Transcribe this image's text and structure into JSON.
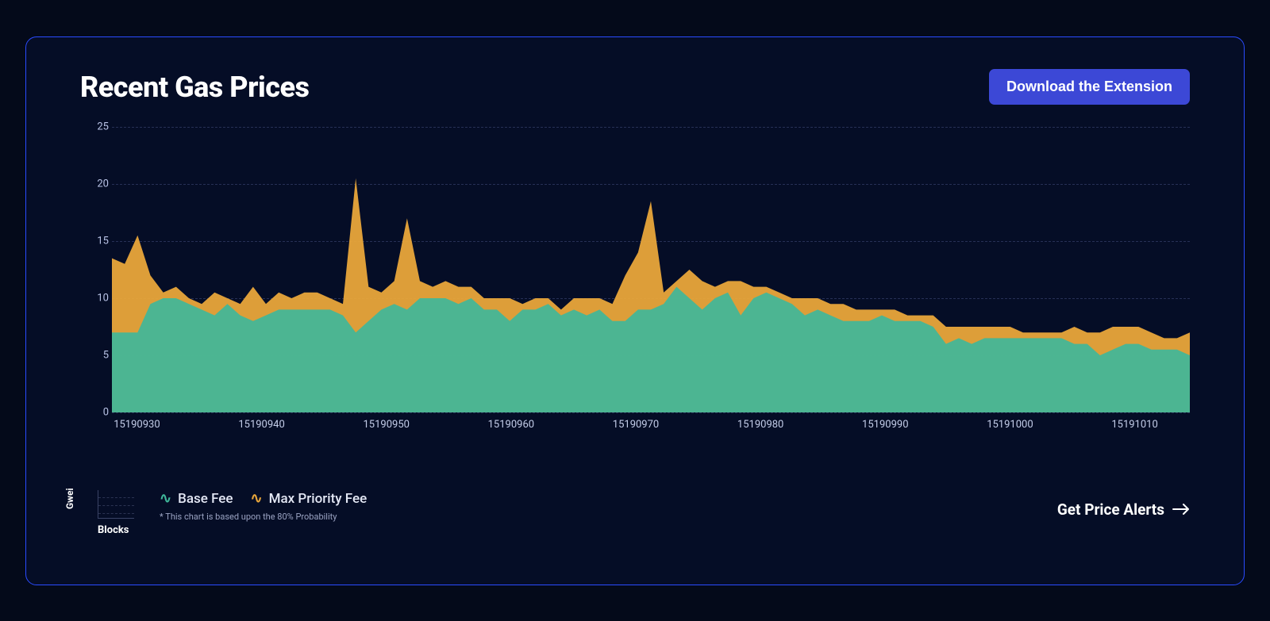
{
  "header": {
    "title": "Recent Gas Prices",
    "download_label": "Download the Extension"
  },
  "chart_data": {
    "type": "area",
    "title": "Recent Gas Prices",
    "xlabel": "Blocks",
    "ylabel": "Gwei",
    "ylim": [
      0,
      25
    ],
    "xlim": [
      15190928,
      15191012
    ],
    "y_ticks": [
      0,
      5,
      10,
      15,
      20,
      25
    ],
    "x_ticks": [
      15190930,
      15190940,
      15190950,
      15190960,
      15190970,
      15190980,
      15190990,
      15191000,
      15191010
    ],
    "categories": [
      15190928,
      15190929,
      15190930,
      15190931,
      15190932,
      15190933,
      15190934,
      15190935,
      15190936,
      15190937,
      15190938,
      15190939,
      15190940,
      15190941,
      15190942,
      15190943,
      15190944,
      15190945,
      15190946,
      15190947,
      15190948,
      15190949,
      15190950,
      15190951,
      15190952,
      15190953,
      15190954,
      15190955,
      15190956,
      15190957,
      15190958,
      15190959,
      15190960,
      15190961,
      15190962,
      15190963,
      15190964,
      15190965,
      15190966,
      15190967,
      15190968,
      15190969,
      15190970,
      15190971,
      15190972,
      15190973,
      15190974,
      15190975,
      15190976,
      15190977,
      15190978,
      15190979,
      15190980,
      15190981,
      15190982,
      15190983,
      15190984,
      15190985,
      15190986,
      15190987,
      15190988,
      15190989,
      15190990,
      15190991,
      15190992,
      15190993,
      15190994,
      15190995,
      15190996,
      15190997,
      15190998,
      15190999,
      15191000,
      15191001,
      15191002,
      15191003,
      15191004,
      15191005,
      15191006,
      15191007,
      15191008,
      15191009,
      15191010,
      15191011,
      15191012
    ],
    "series": [
      {
        "name": "Base Fee",
        "color": "#3fb79a",
        "values": [
          7.0,
          7.0,
          7.0,
          9.5,
          10.0,
          10.0,
          9.5,
          9.0,
          8.5,
          9.5,
          8.5,
          8.0,
          8.5,
          9.0,
          9.0,
          9.0,
          9.0,
          9.0,
          8.5,
          7.0,
          8.0,
          9.0,
          9.5,
          9.0,
          10.0,
          10.0,
          10.0,
          9.5,
          10.0,
          9.0,
          9.0,
          8.0,
          9.0,
          9.0,
          9.5,
          8.5,
          9.0,
          8.5,
          9.0,
          8.0,
          8.0,
          9.0,
          9.0,
          9.5,
          11.0,
          10.0,
          9.0,
          10.0,
          10.5,
          8.5,
          10.0,
          10.5,
          10.0,
          9.5,
          8.5,
          9.0,
          8.5,
          8.0,
          8.0,
          8.0,
          8.5,
          8.0,
          8.0,
          8.0,
          7.5,
          6.0,
          6.5,
          6.0,
          6.5,
          6.5,
          6.5,
          6.5,
          6.5,
          6.5,
          6.5,
          6.0,
          6.0,
          5.0,
          5.5,
          6.0,
          6.0,
          5.5,
          5.5,
          5.5,
          5.0
        ]
      },
      {
        "name": "Max Priority Fee",
        "color": "#e9a63a",
        "values": [
          13.5,
          13.0,
          15.5,
          12.0,
          10.5,
          11.0,
          10.0,
          9.5,
          10.5,
          10.0,
          9.5,
          11.0,
          9.5,
          10.5,
          10.0,
          10.5,
          10.5,
          10.0,
          9.5,
          20.5,
          11.0,
          10.5,
          11.5,
          17.0,
          11.5,
          11.0,
          11.5,
          11.0,
          11.0,
          10.0,
          10.0,
          10.0,
          9.5,
          10.0,
          10.0,
          9.0,
          10.0,
          10.0,
          10.0,
          9.5,
          12.0,
          14.0,
          18.5,
          10.5,
          11.5,
          12.5,
          11.5,
          11.0,
          11.5,
          11.5,
          11.0,
          11.0,
          10.5,
          10.0,
          10.0,
          10.0,
          9.5,
          9.5,
          9.0,
          9.0,
          9.0,
          9.0,
          8.5,
          8.5,
          8.5,
          7.5,
          7.5,
          7.5,
          7.5,
          7.5,
          7.5,
          7.0,
          7.0,
          7.0,
          7.0,
          7.5,
          7.0,
          7.0,
          7.5,
          7.5,
          7.5,
          7.0,
          6.5,
          6.5,
          7.0
        ]
      }
    ]
  },
  "legend": {
    "axis_y": "Gwei",
    "axis_x": "Blocks",
    "base_fee": "Base Fee",
    "max_priority": "Max Priority Fee",
    "note": "* This chart is based upon the 80% Probability"
  },
  "alerts_link": "Get Price Alerts",
  "colors": {
    "teal": "#3fb79a",
    "amber": "#e9a63a",
    "accent": "#3c48d6"
  }
}
